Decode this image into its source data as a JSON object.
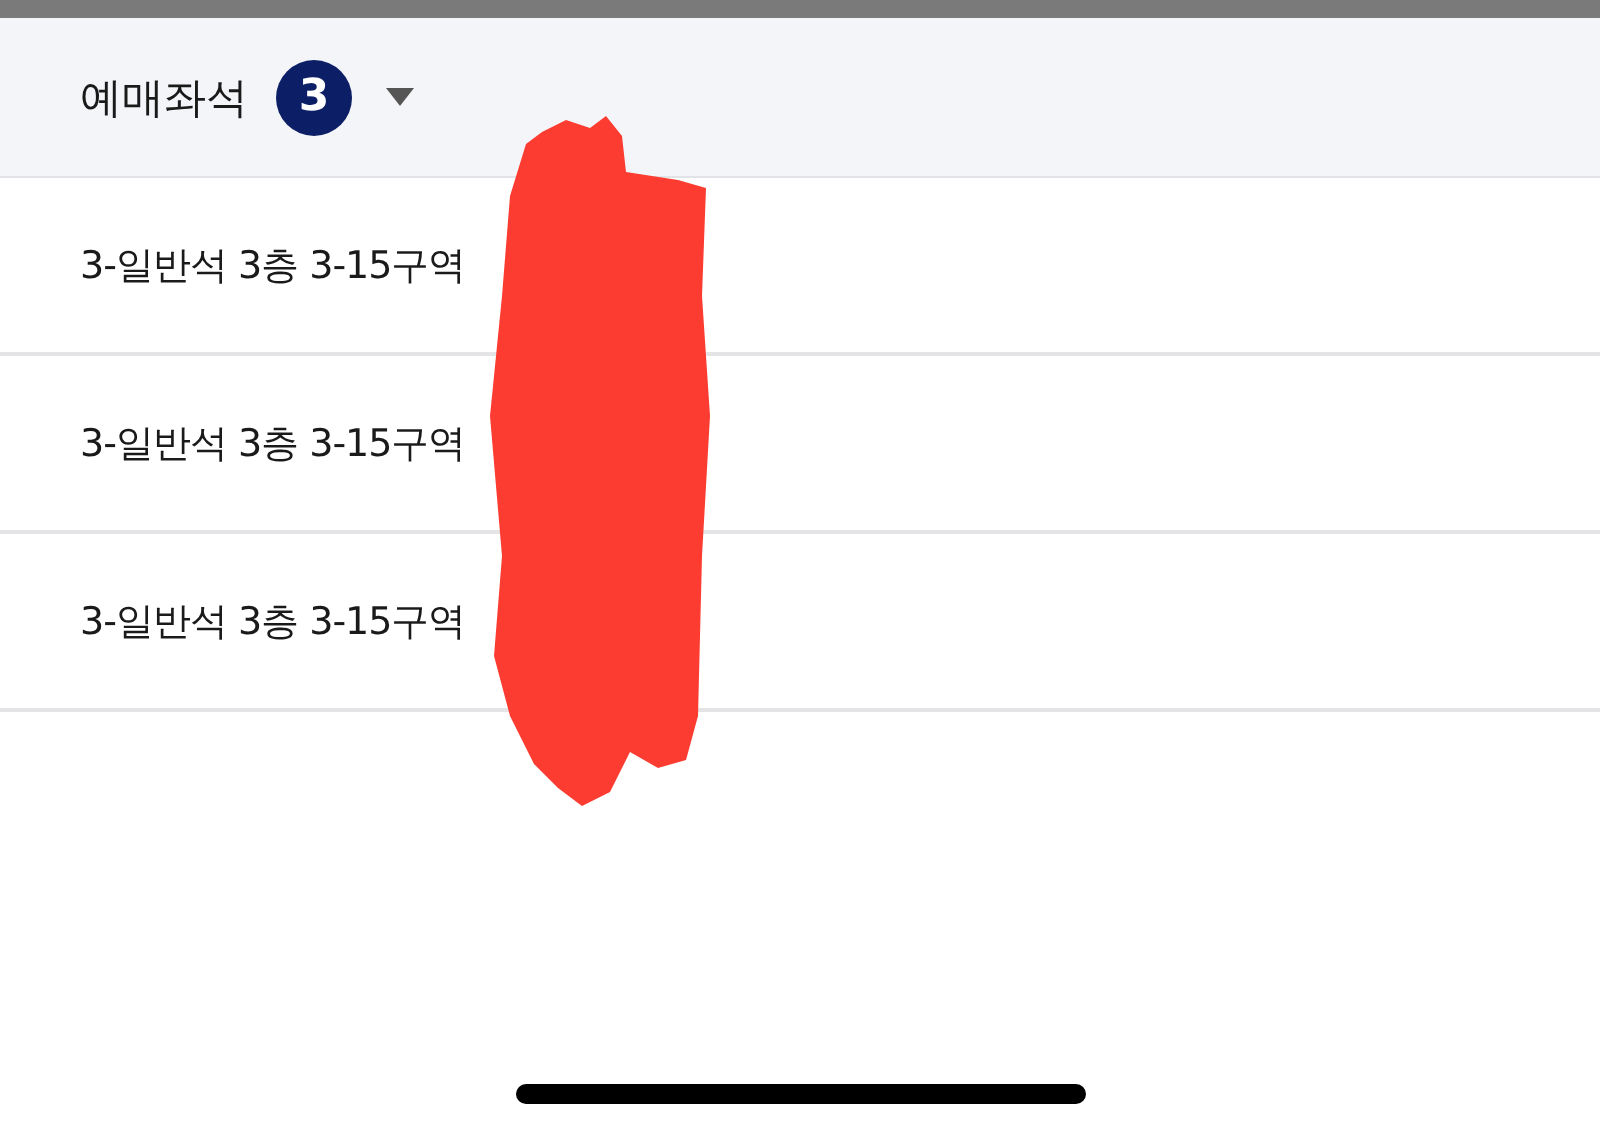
{
  "header": {
    "title": "예매좌석",
    "count": "3"
  },
  "seats": [
    {
      "label": "3-일반석 3층 3-15구역"
    },
    {
      "label": "3-일반석 3층 3-15구역"
    },
    {
      "label": "3-일반석 3층 3-15구역"
    }
  ]
}
